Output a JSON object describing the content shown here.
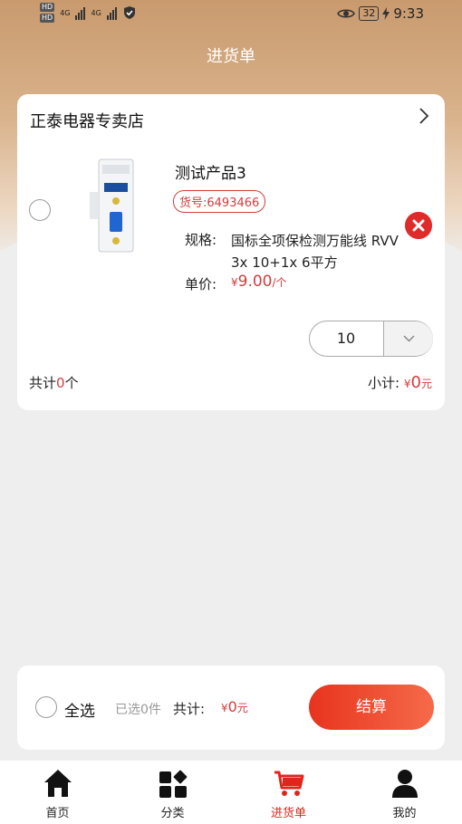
{
  "status_bar": {
    "hd1": "HD",
    "sig1": "4G",
    "hd2": "HD",
    "sig2": "4G",
    "battery": "32",
    "time": "9:33",
    "icons": [
      "shield-check-icon",
      "eye-icon",
      "charging-icon"
    ]
  },
  "header": {
    "title": "进货单"
  },
  "shop": {
    "name": "正泰电器专卖店",
    "item": {
      "name": "测试产品3",
      "sku": "货号:6493466",
      "spec_label": "规格:",
      "spec_value": "国标全项保检测万能线 RVV 3x 10+1x 6平方",
      "price_label": "单价:",
      "price_currency": "¥",
      "price_value": "9.00",
      "price_unit": "/个",
      "quantity": "10"
    },
    "total_count_prefix": "共计",
    "total_count_num": "0",
    "total_count_suffix": "个",
    "subtotal_label": "小计:",
    "subtotal_currency": "¥",
    "subtotal_value": "0",
    "subtotal_unit": "元"
  },
  "checkout": {
    "select_all": "全选",
    "selected": "已选0件",
    "total_label": "共计:",
    "total_currency": "¥",
    "total_value": "0",
    "total_unit": "元",
    "button": "结算"
  },
  "tabbar": {
    "items": [
      {
        "label": "首页",
        "icon": "home-icon"
      },
      {
        "label": "分类",
        "icon": "category-icon"
      },
      {
        "label": "进货单",
        "icon": "cart-icon"
      },
      {
        "label": "我的",
        "icon": "user-icon"
      }
    ],
    "active_index": 2
  },
  "colors": {
    "accent": "#e0261c",
    "price_red": "#d23d3d",
    "header_brown": "#c99a6e"
  }
}
